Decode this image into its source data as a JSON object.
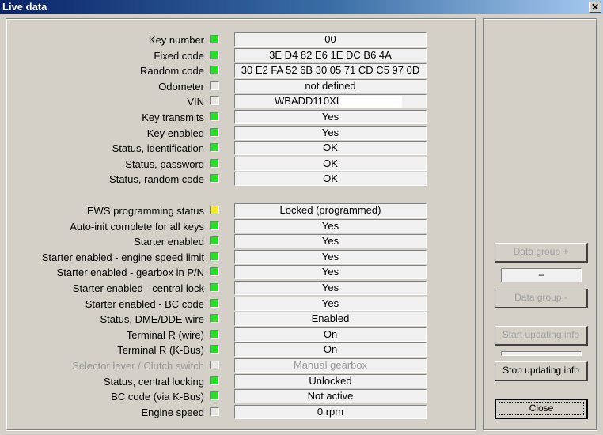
{
  "window": {
    "title": "Live data",
    "close_glyph": "✕"
  },
  "group1": [
    {
      "label": "Key number",
      "status": "green",
      "value": "00"
    },
    {
      "label": "Fixed code",
      "status": "green",
      "value": "3E D4 82 E6 1E DC B6 4A"
    },
    {
      "label": "Random code",
      "status": "green",
      "value": "30 E2 FA 52 6B 30 05 71 CD C5 97 0D"
    },
    {
      "label": "Odometer",
      "status": "grey",
      "value": "not defined"
    },
    {
      "label": "VIN",
      "status": "grey",
      "value": "WBADD110XI"
    },
    {
      "label": "Key transmits",
      "status": "green",
      "value": "Yes"
    },
    {
      "label": "Key enabled",
      "status": "green",
      "value": "Yes"
    },
    {
      "label": "Status, identification",
      "status": "green",
      "value": "OK"
    },
    {
      "label": "Status, password",
      "status": "green",
      "value": "OK"
    },
    {
      "label": "Status, random code",
      "status": "green",
      "value": "OK"
    }
  ],
  "group2": [
    {
      "label": "EWS programming status",
      "status": "yellow",
      "value": "Locked (programmed)"
    },
    {
      "label": "Auto-init complete for all keys",
      "status": "green",
      "value": "Yes"
    },
    {
      "label": "Starter enabled",
      "status": "green",
      "value": "Yes"
    },
    {
      "label": "Starter enabled - engine speed limit",
      "status": "green",
      "value": "Yes"
    },
    {
      "label": "Starter enabled - gearbox in P/N",
      "status": "green",
      "value": "Yes"
    },
    {
      "label": "Starter enabled - central lock",
      "status": "green",
      "value": "Yes"
    },
    {
      "label": "Starter enabled - BC code",
      "status": "green",
      "value": "Yes"
    },
    {
      "label": "Status, DME/DDE wire",
      "status": "green",
      "value": "Enabled"
    },
    {
      "label": "Terminal R (wire)",
      "status": "green",
      "value": "On"
    },
    {
      "label": "Terminal R (K-Bus)",
      "status": "green",
      "value": "On"
    },
    {
      "label": "Selector lever / Clutch switch",
      "status": "grey",
      "value": "Manual gearbox",
      "disabled": true
    },
    {
      "label": "Status, central locking",
      "status": "green",
      "value": "Unlocked"
    },
    {
      "label": "BC code (via K-Bus)",
      "status": "green",
      "value": "Not active"
    },
    {
      "label": "Engine speed",
      "status": "grey",
      "value": "0 rpm"
    }
  ],
  "status_colors": {
    "green": "#22e022",
    "yellow": "#f5ea2a",
    "grey": "#e8e6e2"
  },
  "side": {
    "data_group_plus": "Data group +",
    "data_group_value": "–",
    "data_group_minus": "Data group -",
    "start_updating": "Start updating info",
    "update_progress": 0,
    "stop_updating": "Stop updating info",
    "close": "Close"
  }
}
